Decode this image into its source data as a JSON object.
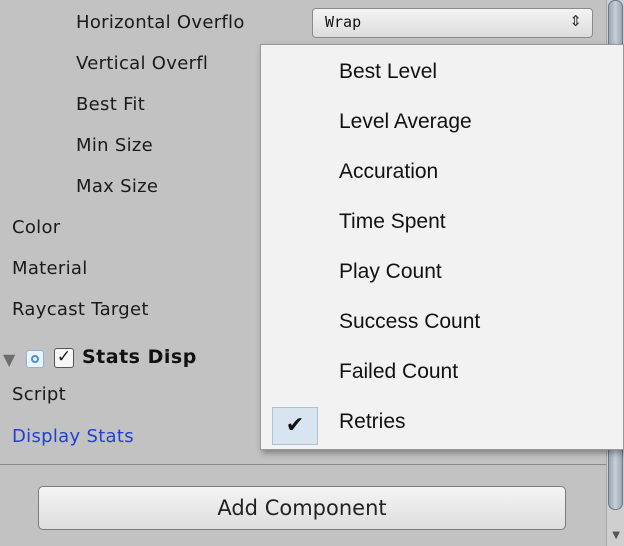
{
  "properties": [
    {
      "label": "Horizontal Overflo",
      "indent": true
    },
    {
      "label": "Vertical Overfl",
      "indent": true
    },
    {
      "label": "Best Fit",
      "indent": true
    },
    {
      "label": "Min Size",
      "indent": true
    },
    {
      "label": "Max Size",
      "indent": true
    },
    {
      "label": "Color",
      "indent": false
    },
    {
      "label": "Material",
      "indent": false
    },
    {
      "label": "Raycast Target",
      "indent": false
    }
  ],
  "horizontal_overflow_value": "Wrap",
  "popup_arrows": "⇕",
  "component": {
    "title": "Stats Disp",
    "enabled": true,
    "foldout_glyph": "▼",
    "check_glyph": "✓",
    "script_label": "Script",
    "display_stats_label": "Display Stats"
  },
  "add_component_label": "Add Component",
  "dropdown": {
    "items": [
      {
        "label": "Best Level",
        "checked": false
      },
      {
        "label": "Level Average",
        "checked": false
      },
      {
        "label": "Accuration",
        "checked": false
      },
      {
        "label": "Time Spent",
        "checked": false
      },
      {
        "label": "Play Count",
        "checked": false
      },
      {
        "label": "Success Count",
        "checked": false
      },
      {
        "label": "Failed Count",
        "checked": false
      },
      {
        "label": "Retries",
        "checked": true
      }
    ],
    "check_glyph": "✔"
  },
  "colors": {
    "inspector_bg": "#c2c2c2",
    "link_label": "#1f3fd6",
    "selected_check_bg": "#d8e5f1"
  }
}
